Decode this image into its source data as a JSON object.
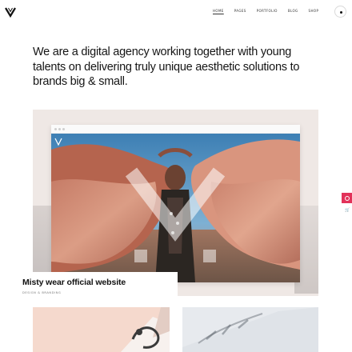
{
  "header": {
    "logo_icon": "v-logo-icon",
    "nav": [
      {
        "label": "Home",
        "active": true
      },
      {
        "label": "Pages",
        "active": false
      },
      {
        "label": "Portfolio",
        "active": false
      },
      {
        "label": "Blog",
        "active": false
      },
      {
        "label": "Shop",
        "active": false
      }
    ],
    "cart_icon": "cart-icon"
  },
  "intro": {
    "text": "We are a digital agency working together with young talents on delivering truly unique aesthetic solutions to brands big & small."
  },
  "featured": {
    "title": "Misty wear official website",
    "category": "Design & Branding"
  },
  "side": {
    "tab_icon": "target-icon",
    "cart_icon": "cart-icon"
  },
  "colors": {
    "accent": "#e2325a",
    "hero_bg": "#efe8e5",
    "thumb1_bg": "#f5d9cd",
    "thumb2_bg": "#e7eaee"
  }
}
